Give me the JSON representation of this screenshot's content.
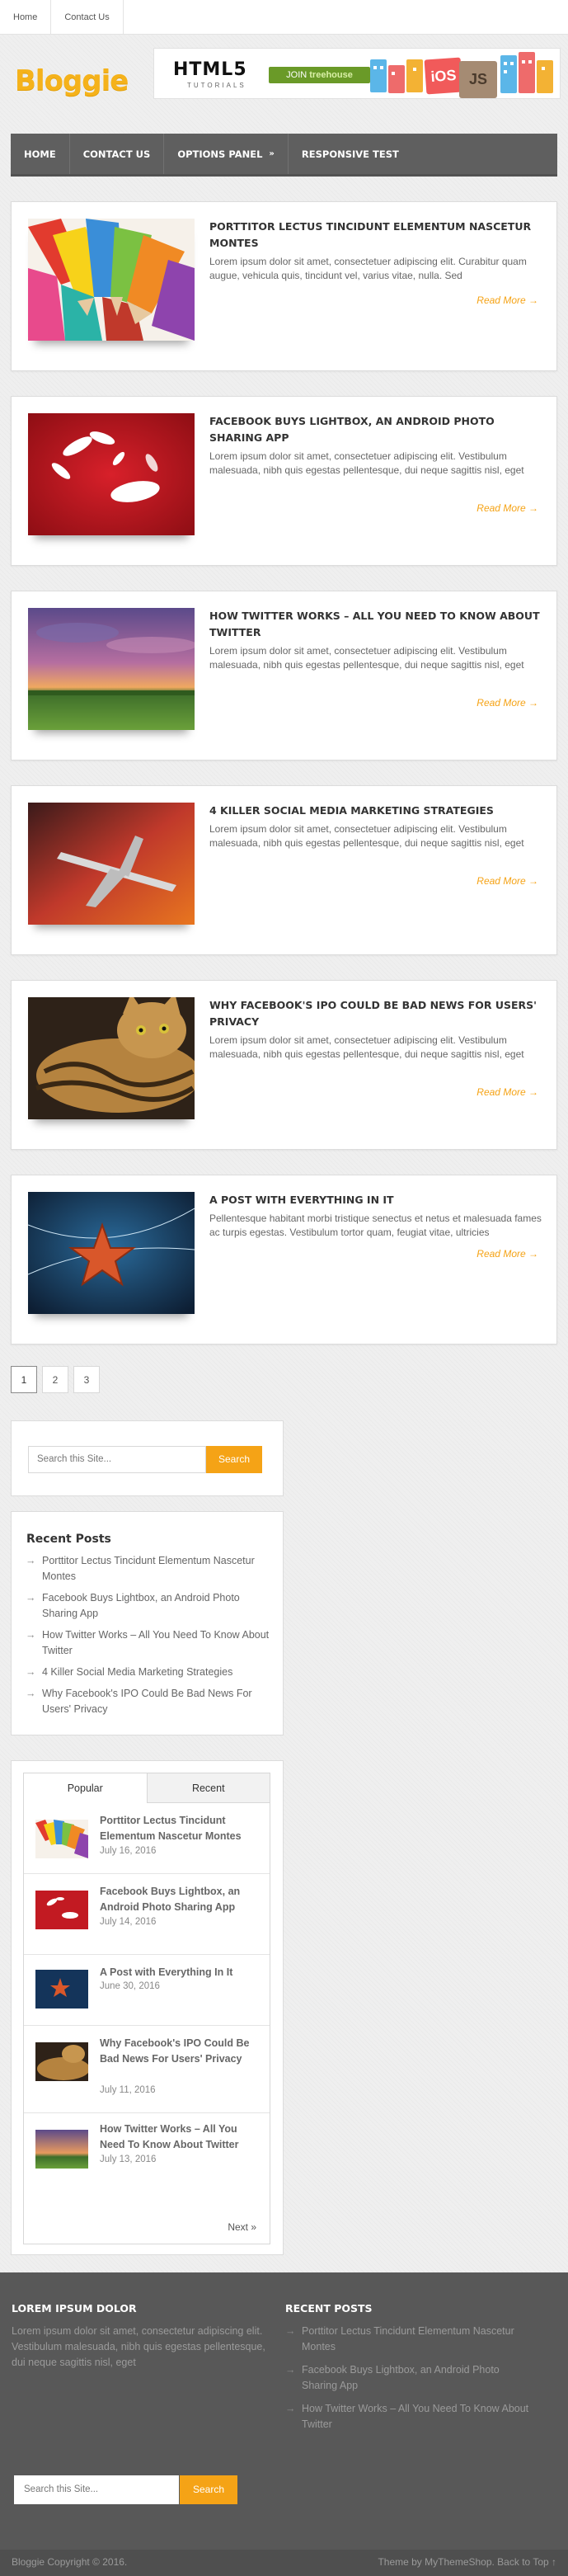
{
  "topbar": {
    "links": [
      "Home",
      "Contact Us"
    ]
  },
  "header": {
    "logo": "Bloggie"
  },
  "banner": {
    "headline": "HTML5",
    "subline": "TUTORIALS",
    "cta_prefix": "JOIN",
    "cta_brand": "treehouse",
    "badge_ios": "iOS",
    "badge_js": "JS"
  },
  "nav": {
    "items": [
      "HOME",
      "CONTACT US",
      "OPTIONS PANEL",
      "RESPONSIVE TEST"
    ],
    "submenu_arrow": "»"
  },
  "posts": [
    {
      "title": "PORTTITOR LECTUS TINCIDUNT ELEMENTUM NASCETUR MONTES",
      "excerpt": "Lorem ipsum dolor sit amet, consectetuer adipiscing elit. Curabitur quam augue, vehicula quis, tincidunt vel, varius vitae, nulla. Sed",
      "read_more": "Read More →"
    },
    {
      "title": "FACEBOOK BUYS LIGHTBOX, AN ANDROID PHOTO SHARING APP",
      "excerpt": "Lorem ipsum dolor sit amet, consectetuer adipiscing elit. Vestibulum malesuada, nibh quis egestas pellentesque, dui neque sagittis nisl, eget",
      "read_more": "Read More →"
    },
    {
      "title": "HOW TWITTER WORKS – ALL YOU NEED TO KNOW ABOUT TWITTER",
      "excerpt": "Lorem ipsum dolor sit amet, consectetuer adipiscing elit. Vestibulum malesuada, nibh quis egestas pellentesque, dui neque sagittis nisl, eget",
      "read_more": "Read More →"
    },
    {
      "title": "4 KILLER SOCIAL MEDIA MARKETING STRATEGIES",
      "excerpt": "Lorem ipsum dolor sit amet, consectetuer adipiscing elit. Vestibulum malesuada, nibh quis egestas pellentesque, dui neque sagittis nisl, eget",
      "read_more": "Read More →"
    },
    {
      "title": "WHY FACEBOOK'S IPO COULD BE BAD NEWS FOR USERS' PRIVACY",
      "excerpt": "Lorem ipsum dolor sit amet, consectetuer adipiscing elit. Vestibulum malesuada, nibh quis egestas pellentesque, dui neque sagittis nisl, eget",
      "read_more": "Read More →"
    },
    {
      "title": "A POST WITH EVERYTHING IN IT",
      "excerpt": "Pellentesque habitant morbi tristique senectus et netus et malesuada fames ac turpis egestas. Vestibulum tortor quam, feugiat vitae, ultricies",
      "read_more": "Read More →"
    }
  ],
  "pagination": {
    "pages": [
      "1",
      "2",
      "3"
    ],
    "current": "1"
  },
  "sidebar_search": {
    "placeholder": "Search this Site...",
    "button": "Search"
  },
  "recent_posts": {
    "title": "Recent Posts",
    "arrow": "→",
    "items": [
      "Porttitor Lectus Tincidunt Elementum Nascetur Montes",
      "Facebook Buys Lightbox, an Android Photo Sharing App",
      "How Twitter Works – All You Need To Know About Twitter",
      "4 Killer Social Media Marketing Strategies",
      "Why Facebook's IPO Could Be Bad News For Users' Privacy"
    ]
  },
  "tabs_widget": {
    "tabs": [
      "Popular",
      "Recent"
    ],
    "active_tab": "Popular",
    "items": [
      {
        "title": "Porttitor Lectus Tincidunt Elementum Nascetur Montes",
        "date": "July 16, 2016"
      },
      {
        "title": "Facebook Buys Lightbox, an Android Photo Sharing App",
        "date": "July 14, 2016"
      },
      {
        "title": "A Post with Everything In It",
        "date": "June 30, 2016"
      },
      {
        "title": "Why Facebook's IPO Could Be Bad News For Users' Privacy",
        "date": "July 11, 2016"
      },
      {
        "title": "How Twitter Works – All You Need To Know About Twitter",
        "date": "July 13, 2016"
      }
    ],
    "next": "Next »"
  },
  "footer": {
    "col1_title": "LOREM IPSUM DOLOR",
    "col1_text": "Lorem ipsum dolor sit amet, consectetur adipiscing elit. Vestibulum malesuada, nibh quis egestas pellentesque, dui neque sagittis nisl, eget",
    "col2_title": "RECENT POSTS",
    "arrow": "→",
    "recent": [
      "Porttitor Lectus Tincidunt Elementum Nascetur Montes",
      "Facebook Buys Lightbox, an Android Photo Sharing App",
      "How Twitter Works – All You Need To Know About Twitter"
    ],
    "search_placeholder": "Search this Site...",
    "search_button": "Search",
    "copyright": "Bloggie Copyright © 2016.",
    "credits": "Theme by MyThemeShop. Back to Top ↑"
  },
  "colors": {
    "accent": "#f5a316",
    "logo": "#f5b21b",
    "nav": "#5f5f5f",
    "footer": "#585858"
  }
}
